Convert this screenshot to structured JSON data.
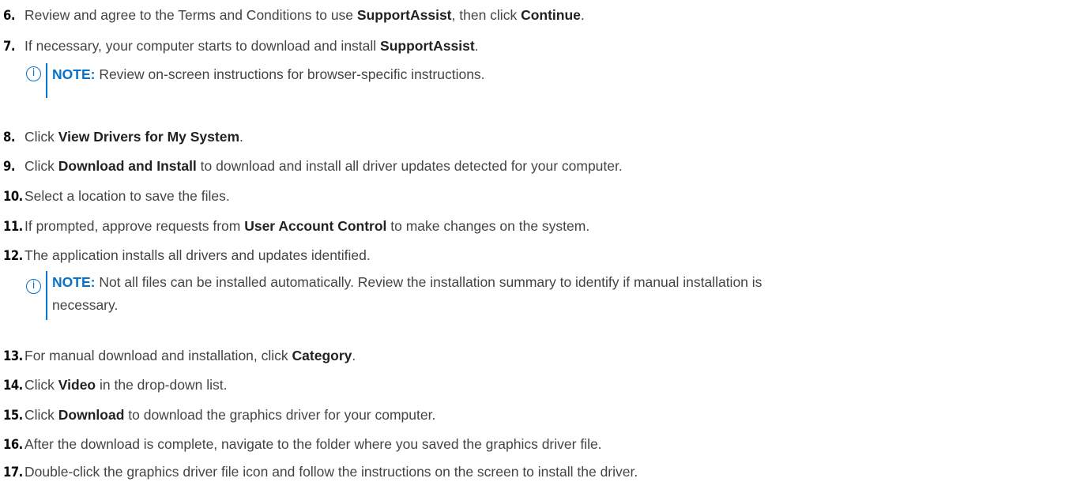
{
  "steps": [
    {
      "num": "6.",
      "a": "Review and agree to the Terms and Conditions to use ",
      "b1": "SupportAssist",
      "c": ", then click ",
      "b2": "Continue",
      "d": "."
    },
    {
      "num": "7.",
      "a": "If necessary, your computer starts to download and install ",
      "b1": "SupportAssist",
      "c": "."
    },
    {
      "num": "8.",
      "a": "Click ",
      "b1": "View Drivers for My System",
      "c": "."
    },
    {
      "num": "9.",
      "a": "Click ",
      "b1": "Download and Install",
      "c": " to download and install all driver updates detected for your computer."
    },
    {
      "num": "10.",
      "a": "Select a location to save the files."
    },
    {
      "num": "11.",
      "a": "If prompted, approve requests from ",
      "b1": "User Account Control",
      "c": " to make changes on the system."
    },
    {
      "num": "12.",
      "a": "The application installs all drivers and updates identified."
    },
    {
      "num": "13.",
      "a": "For manual download and installation, click ",
      "b1": "Category",
      "c": "."
    },
    {
      "num": "14.",
      "a": "Click ",
      "b1": "Video",
      "c": " in the drop-down list."
    },
    {
      "num": "15.",
      "a": "Click ",
      "b1": "Download",
      "c": " to download the graphics driver for your computer."
    },
    {
      "num": "16.",
      "a": "After the download is complete, navigate to the folder where you saved the graphics driver file."
    },
    {
      "num": "17.",
      "a": "Double-click the graphics driver file icon and follow the instructions on the screen to install the driver."
    }
  ],
  "notes": [
    {
      "label": "NOTE:",
      "text": " Review on-screen instructions for browser-specific instructions."
    },
    {
      "label": "NOTE:",
      "text_line1": " Not all files can be installed automatically. Review the installation summary to identify if manual installation is",
      "text_line2": "necessary."
    }
  ],
  "icons": {
    "info": "info-circle-icon",
    "accent_color": "#0672cb"
  }
}
